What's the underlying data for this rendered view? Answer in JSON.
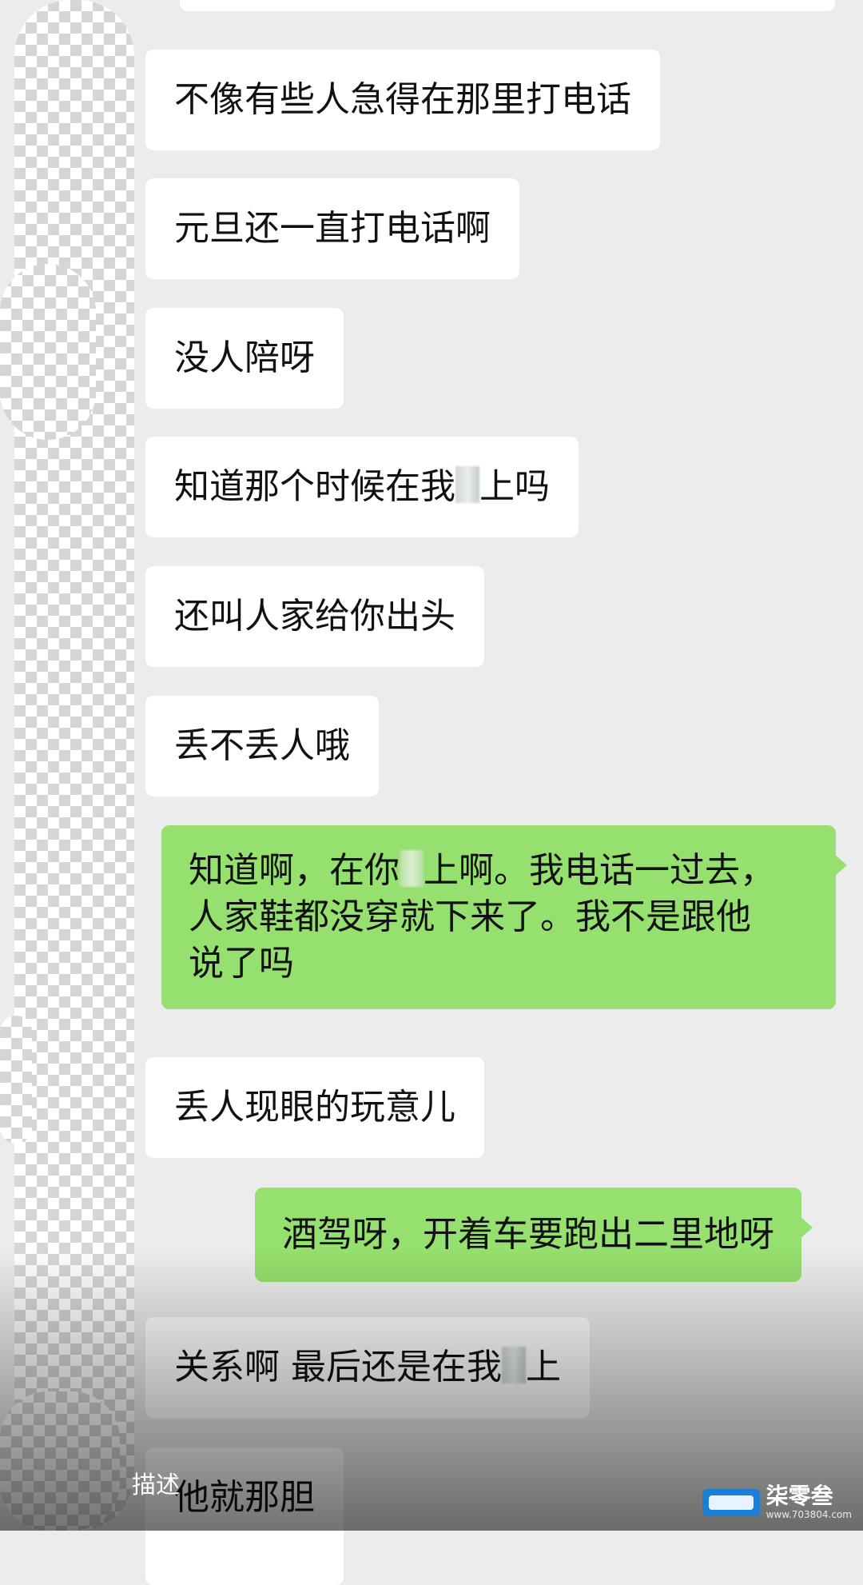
{
  "messages": [
    {
      "side": "in",
      "text": "不像有些人急得在那里打电话"
    },
    {
      "side": "in",
      "text": "元旦还一直打电话啊"
    },
    {
      "side": "in",
      "text": "没人陪呀"
    },
    {
      "side": "in",
      "text_before": "知道那个时候在我",
      "text_after": "上吗"
    },
    {
      "side": "in",
      "text": "还叫人家给你出头"
    },
    {
      "side": "in",
      "text": "丢不丢人哦"
    },
    {
      "side": "out",
      "line1_before": "知道啊，在你",
      "line1_after": "上啊。我电话一过去，",
      "line2": "人家鞋都没穿就下来了。我不是跟他",
      "line3": "说了吗"
    },
    {
      "side": "in",
      "text": "丢人现眼的玩意儿"
    },
    {
      "side": "out",
      "text": "酒驾呀，开着车要跑出二里地呀"
    },
    {
      "side": "in",
      "text_before": "关系啊 最后还是在我",
      "text_after": "上"
    },
    {
      "side": "in",
      "text": "他就那胆"
    }
  ],
  "overlay": {
    "describe_label": "描述"
  },
  "watermark": {
    "text": "柒零叁",
    "url": "www.703804.com"
  }
}
